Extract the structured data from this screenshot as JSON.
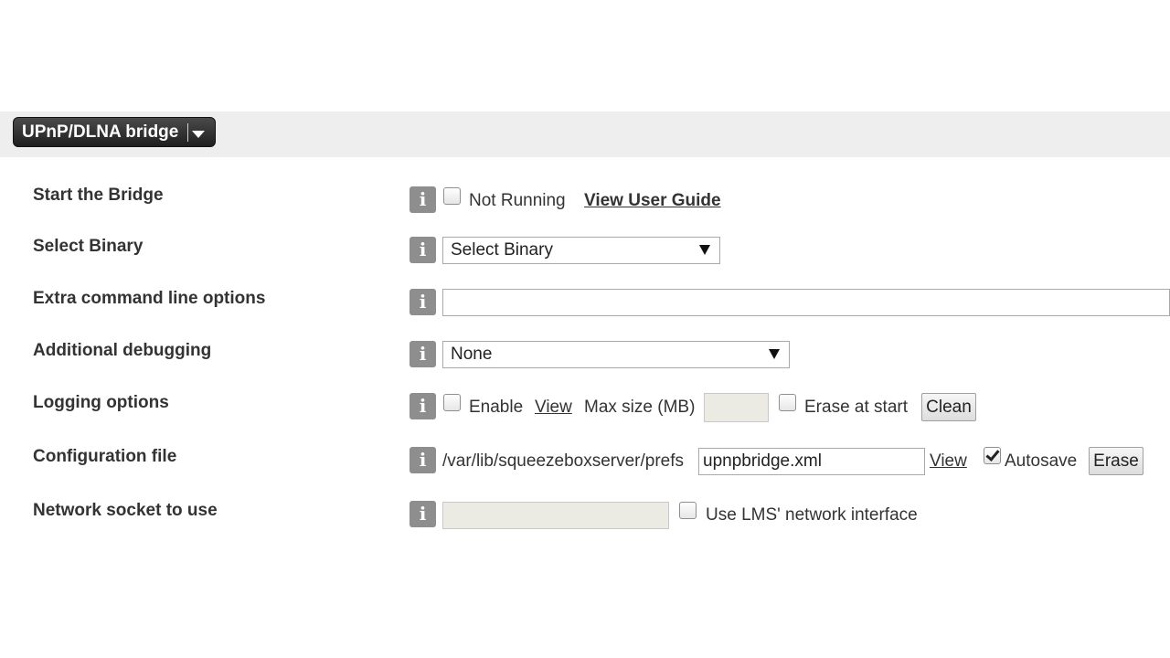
{
  "header": {
    "plugin_menu_label": "UPnP/DLNA bridge"
  },
  "rows": {
    "start": {
      "label": "Start the Bridge",
      "status": "Not Running",
      "guide_link": "View User Guide"
    },
    "binary": {
      "label": "Select Binary",
      "selected": "Select Binary"
    },
    "extra": {
      "label": "Extra command line options",
      "value": ""
    },
    "debug": {
      "label": "Additional debugging",
      "selected": "None"
    },
    "logging": {
      "label": "Logging options",
      "enable": "Enable",
      "view": "View",
      "maxsize": "Max size (MB)",
      "maxsize_value": "",
      "erase_at_start": "Erase at start",
      "clean": "Clean"
    },
    "config": {
      "label": "Configuration file",
      "path": "/var/lib/squeezeboxserver/prefs",
      "filename": "upnpbridge.xml",
      "view": "View",
      "autosave": "Autosave",
      "autosave_checked": true,
      "erase": "Erase"
    },
    "socket": {
      "label": "Network socket to use",
      "value": "",
      "use_lms": "Use LMS' network interface"
    }
  },
  "icons": {
    "info": "i"
  },
  "colors": {
    "header_band": "#eeeeee",
    "menu_button": "#2b2b2b",
    "info_icon": "#8e8e8e"
  }
}
